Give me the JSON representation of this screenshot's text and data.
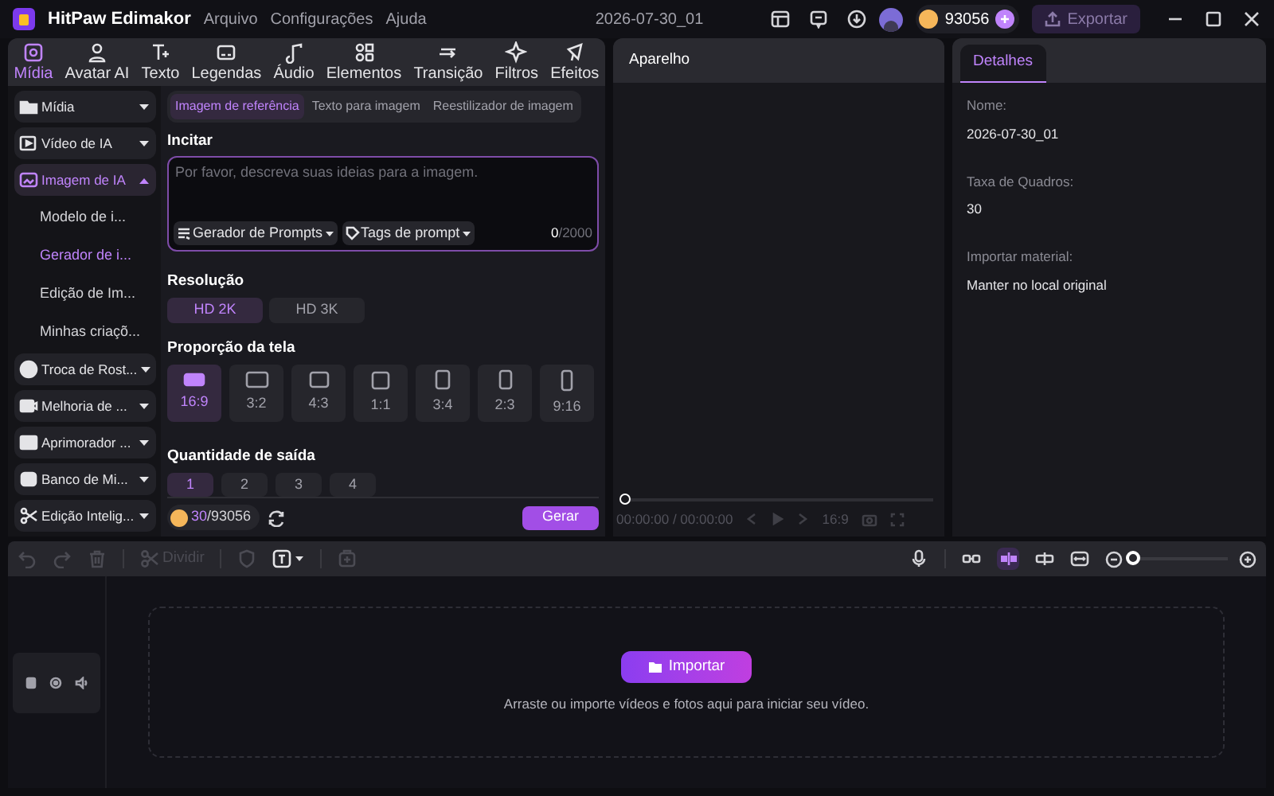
{
  "app": {
    "title": "HitPaw Edimakor",
    "menu": [
      "Arquivo",
      "Configurações",
      "Ajuda"
    ],
    "project_name": "2026-07-30_01",
    "credits": "93056",
    "export": "Exportar"
  },
  "top_tabs": [
    {
      "label": "Mídia",
      "selected": true
    },
    {
      "label": "Avatar AI",
      "selected": false
    },
    {
      "label": "Texto",
      "selected": false
    },
    {
      "label": "Legendas",
      "selected": false
    },
    {
      "label": "Áudio",
      "selected": false
    },
    {
      "label": "Elementos",
      "selected": false
    },
    {
      "label": "Transição",
      "selected": false
    },
    {
      "label": "Filtros",
      "selected": false
    },
    {
      "label": "Efeitos",
      "selected": false
    }
  ],
  "sidebar": [
    {
      "label": "Mídia",
      "expanded": false,
      "selected": false
    },
    {
      "label": "Vídeo de IA",
      "expanded": false,
      "selected": false
    },
    {
      "label": "Imagem de IA",
      "expanded": true,
      "selected": true,
      "children": [
        {
          "label": "Modelo de i...",
          "selected": false
        },
        {
          "label": "Gerador de i...",
          "selected": true
        },
        {
          "label": "Edição de Im...",
          "selected": false
        },
        {
          "label": "Minhas criaçõ...",
          "selected": false
        }
      ]
    },
    {
      "label": "Troca de Rost...",
      "expanded": false,
      "selected": false
    },
    {
      "label": "Melhoria de ...",
      "expanded": false,
      "selected": false
    },
    {
      "label": "Aprimorador ...",
      "expanded": false,
      "selected": false
    },
    {
      "label": "Banco de Mi...",
      "expanded": false,
      "selected": false
    },
    {
      "label": "Edição Intelig...",
      "expanded": false,
      "selected": false
    }
  ],
  "generator": {
    "modes": [
      {
        "label": "Imagem de referência",
        "selected": true
      },
      {
        "label": "Texto para imagem",
        "selected": false
      },
      {
        "label": "Reestilizador de imagem",
        "selected": false
      }
    ],
    "prompt": {
      "label": "Incitar",
      "placeholder": "Por favor, descreva suas ideias para a imagem.",
      "tools": [
        "Gerador de Prompts",
        "Tags de prompt"
      ],
      "count": "0",
      "limit": "/2000"
    },
    "resolution": {
      "label": "Resolução",
      "options": [
        {
          "label": "HD 2K",
          "selected": true
        },
        {
          "label": "HD 3K",
          "selected": false
        }
      ]
    },
    "aspect": {
      "label": "Proporção da tela",
      "options": [
        {
          "label": "16:9",
          "selected": true
        },
        {
          "label": "3:2",
          "selected": false
        },
        {
          "label": "4:3",
          "selected": false
        },
        {
          "label": "1:1",
          "selected": false
        },
        {
          "label": "3:4",
          "selected": false
        },
        {
          "label": "2:3",
          "selected": false
        },
        {
          "label": "9:16",
          "selected": false
        }
      ]
    },
    "quantity": {
      "label": "Quantidade de saída",
      "options": [
        {
          "label": "1",
          "selected": true
        },
        {
          "label": "2",
          "selected": false
        },
        {
          "label": "3",
          "selected": false
        },
        {
          "label": "4",
          "selected": false
        }
      ]
    },
    "cost": {
      "used": "30",
      "total": "/93056"
    },
    "generate": "Gerar"
  },
  "preview": {
    "title": "Aparelho",
    "level": 0,
    "time": "00:00:00 / 00:00:00",
    "ratio": "16:9"
  },
  "details": {
    "tab": "Detalhes",
    "fields": [
      {
        "label": "Nome:",
        "value": "2026-07-30_01"
      },
      {
        "label": "Taxa de Quadros:",
        "value": "30"
      },
      {
        "label": "Importar material:",
        "value": "Manter no local original"
      }
    ]
  },
  "timeline": {
    "split": "Dividir",
    "zoom": {
      "level": 0
    },
    "import": "Importar",
    "hint": "Arraste ou importe vídeos e fotos aqui para iniciar seu vídeo."
  }
}
